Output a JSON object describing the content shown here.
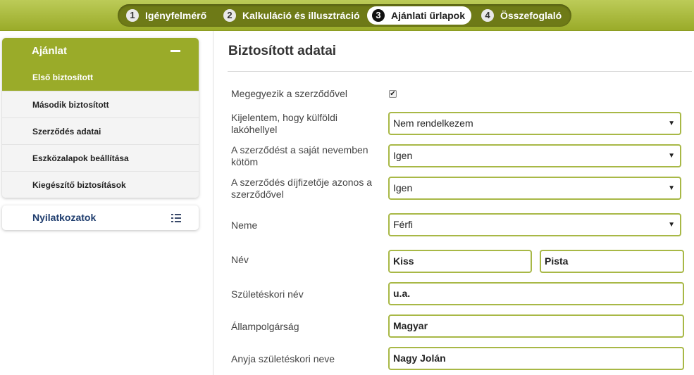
{
  "steps": [
    {
      "num": "1",
      "label": "Igényfelmérő"
    },
    {
      "num": "2",
      "label": "Kalkuláció és illusztráció"
    },
    {
      "num": "3",
      "label": "Ajánlati űrlapok"
    },
    {
      "num": "4",
      "label": "Összefoglaló"
    }
  ],
  "sidebar": {
    "panel_title": "Ajánlat",
    "items": [
      {
        "label": "Első biztosított"
      },
      {
        "label": "Második biztosított"
      },
      {
        "label": "Szerződés adatai"
      },
      {
        "label": "Eszközalapok beállítása"
      },
      {
        "label": "Kiegészítő biztosítások"
      }
    ],
    "panel2_title": "Nyilatkozatok"
  },
  "main": {
    "title": "Biztosított adatai",
    "fields": {
      "same_as_contract": {
        "label": "Megegyezik a szerződővel",
        "checked": true,
        "mark": "✔"
      },
      "foreign_residence": {
        "label": "Kijelentem, hogy külföldi lakóhellyel",
        "value": "Nem rendelkezem"
      },
      "own_name": {
        "label": "A szerződést a saját nevemben kötöm",
        "value": "Igen"
      },
      "payer_same": {
        "label": "A szerződés díjfizetője azonos a szerződővel",
        "value": "Igen"
      },
      "gender": {
        "label": "Neme",
        "value": "Férfi"
      },
      "name": {
        "label": "Név",
        "last": "Kiss",
        "first": "Pista"
      },
      "birth_name": {
        "label": "Születéskori név",
        "value": "u.a."
      },
      "citizenship": {
        "label": "Állampolgárság",
        "value": "Magyar"
      },
      "mother_name": {
        "label": "Anyja születéskori neve",
        "value": "Nagy Jolán"
      }
    },
    "caret": "▼"
  },
  "colors": {
    "accent": "#9aab29",
    "field_border": "#a8b846",
    "nav_dark": "#6e7a17"
  }
}
